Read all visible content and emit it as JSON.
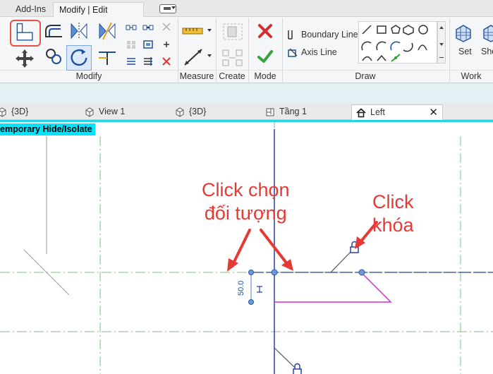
{
  "ribbon_tabs": [
    "Add-Ins",
    "Modify | Edit Revolve"
  ],
  "ribbon_panels": {
    "modify": "Modify",
    "measure": "Measure",
    "create": "Create",
    "mode": "Mode",
    "draw": "Draw",
    "work": "Work"
  },
  "draw_tools": {
    "boundary_line": "Boundary Line",
    "axis_line": "Axis Line"
  },
  "work_tools": {
    "set": "Set",
    "show": "Sho"
  },
  "view_tabs": [
    {
      "label": "{3D}",
      "icon": "cube-icon"
    },
    {
      "label": "View 1",
      "icon": "cube-icon"
    },
    {
      "label": "{3D}",
      "icon": "cube-icon"
    },
    {
      "label": "Tầng 1",
      "icon": "floorplan-icon"
    },
    {
      "label": "Left",
      "icon": "house-icon",
      "active": true
    }
  ],
  "canvas": {
    "badge": "emporary Hide/Isolate",
    "dimension": "50.0",
    "annotation_select": [
      "Click chọn",
      "đối tượng"
    ],
    "annotation_lock": [
      "Click",
      "khóa"
    ]
  },
  "colors": {
    "accent_red": "#e53935",
    "badge_cyan": "#00e5ff",
    "view_edge_cyan": "#27d4e3",
    "axis_blue": "#2b3ea8",
    "boundary_magenta": "#cc33cc"
  }
}
